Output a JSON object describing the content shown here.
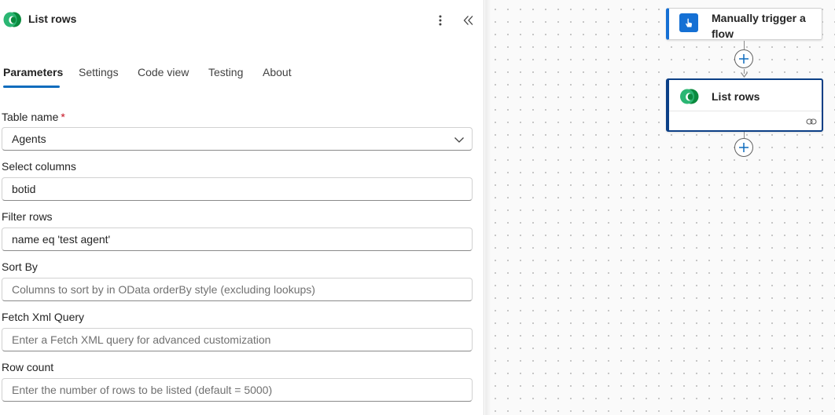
{
  "panel": {
    "title": "List rows",
    "more_options_icon": "more-vertical-icon",
    "collapse_icon": "collapse-double-chevron-icon"
  },
  "tabs": [
    {
      "label": "Parameters",
      "active": true
    },
    {
      "label": "Settings",
      "active": false
    },
    {
      "label": "Code view",
      "active": false
    },
    {
      "label": "Testing",
      "active": false
    },
    {
      "label": "About",
      "active": false
    }
  ],
  "fields": {
    "table_name": {
      "label": "Table name",
      "required_marker": "*",
      "value": "Agents"
    },
    "select_columns": {
      "label": "Select columns",
      "value": "botid"
    },
    "filter_rows": {
      "label": "Filter rows",
      "value": "name eq 'test agent'"
    },
    "sort_by": {
      "label": "Sort By",
      "placeholder": "Columns to sort by in OData orderBy style (excluding lookups)"
    },
    "fetch_xml": {
      "label": "Fetch Xml Query",
      "placeholder": "Enter a Fetch XML query for advanced customization"
    },
    "row_count": {
      "label": "Row count",
      "placeholder": "Enter the number of rows to be listed (default = 5000)"
    }
  },
  "canvas": {
    "trigger_node": {
      "title": "Manually trigger a flow",
      "icon": "touch-hand-icon"
    },
    "action_node": {
      "title": "List rows",
      "icon": "dataverse-logo",
      "footer_icon": "link-icon"
    },
    "add_step_icon": "plus-circle-icon"
  },
  "colors": {
    "accent": "#0f6cbd",
    "trigger_blue": "#1570d4",
    "selected_node_border": "#0b3f86",
    "required": "#c50f1f"
  }
}
